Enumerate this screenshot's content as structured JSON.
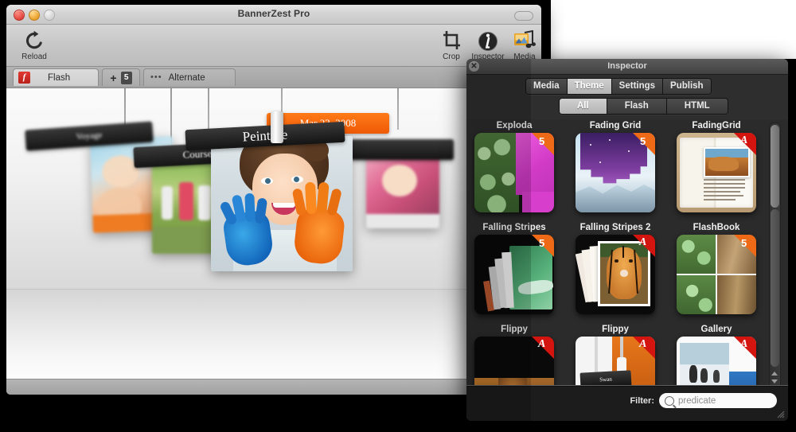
{
  "main_window": {
    "title": "BannerZest Pro",
    "traffic_lights": [
      "close",
      "minimize",
      "zoom"
    ],
    "toolbar": [
      {
        "name": "reload",
        "label": "Reload",
        "icon": "reload-icon"
      },
      {
        "name": "crop",
        "label": "Crop",
        "icon": "crop-icon"
      },
      {
        "name": "inspector",
        "label": "Inspector",
        "icon": "info-icon"
      },
      {
        "name": "media",
        "label": "Media",
        "icon": "media-icon"
      }
    ],
    "tabs": [
      {
        "name": "flash",
        "label": "Flash",
        "icon": "flash-icon",
        "selected": true
      },
      {
        "name": "add-html5",
        "label": "",
        "plus": "+",
        "icon": "html5-icon",
        "badge": "5",
        "selected": false
      },
      {
        "name": "alternate",
        "label": "Alternate",
        "icon": "ellipsis-icon",
        "selected": false
      }
    ],
    "banner": {
      "clip_labels": [
        "Voyage",
        "Course",
        "Peinture"
      ],
      "date_badge": "Mar 23, 2008"
    }
  },
  "inspector": {
    "title": "Inspector",
    "close_glyph": "✕",
    "main_tabs": [
      {
        "label": "Media",
        "selected": false
      },
      {
        "label": "Theme",
        "selected": true
      },
      {
        "label": "Settings",
        "selected": false
      },
      {
        "label": "Publish",
        "selected": false
      }
    ],
    "filter_tabs": [
      {
        "label": "All",
        "selected": true
      },
      {
        "label": "Flash",
        "selected": false
      },
      {
        "label": "HTML",
        "selected": false
      }
    ],
    "theme_rows": [
      {
        "cells": [
          {
            "label": "Exploda",
            "badge": "html5",
            "badge_text": "5",
            "art": "spheres-magenta"
          },
          {
            "label": "Fading Grid",
            "badge": "html5",
            "badge_text": "5",
            "art": "night-sky-mountain"
          },
          {
            "label": "FadingGrid",
            "badge": "flash",
            "badge_text": "A",
            "art": "open-book-tiger"
          }
        ]
      },
      {
        "cells": [
          {
            "label": "Falling Stripes",
            "badge": "html5",
            "badge_text": "5",
            "art": "black-green-cards"
          },
          {
            "label": "Falling Stripes 2",
            "badge": "flash",
            "badge_text": "A",
            "art": "tiger-stack"
          },
          {
            "label": "FlashBook",
            "badge": "html5",
            "badge_text": "5",
            "art": "four-quadrant-green-wood"
          }
        ]
      },
      {
        "cells": [
          {
            "label": "Flippy",
            "badge": "flash",
            "badge_text": "A",
            "art": "dark-tiger-strip"
          },
          {
            "label": "Flippy",
            "badge": "flash",
            "badge_text": "A",
            "art": "swan-caption"
          },
          {
            "label": "Gallery",
            "badge": "flash",
            "badge_text": "A",
            "art": "penguins-white"
          }
        ]
      }
    ],
    "row_overflow_label": "Swan",
    "footer": {
      "filter_label": "Filter:",
      "filter_placeholder": "predicate",
      "filter_value": "",
      "search_icon": "search-icon"
    },
    "scrollbar": {
      "up_arrow": "▲",
      "down_arrow": "▼"
    }
  },
  "colors": {
    "html5_badge": "#ef6a16",
    "flash_badge": "#d4140f",
    "date_badge": "#ff7a18",
    "inspector_bg": "#2b2b2b",
    "window_chrome": "#c8c8c8"
  }
}
